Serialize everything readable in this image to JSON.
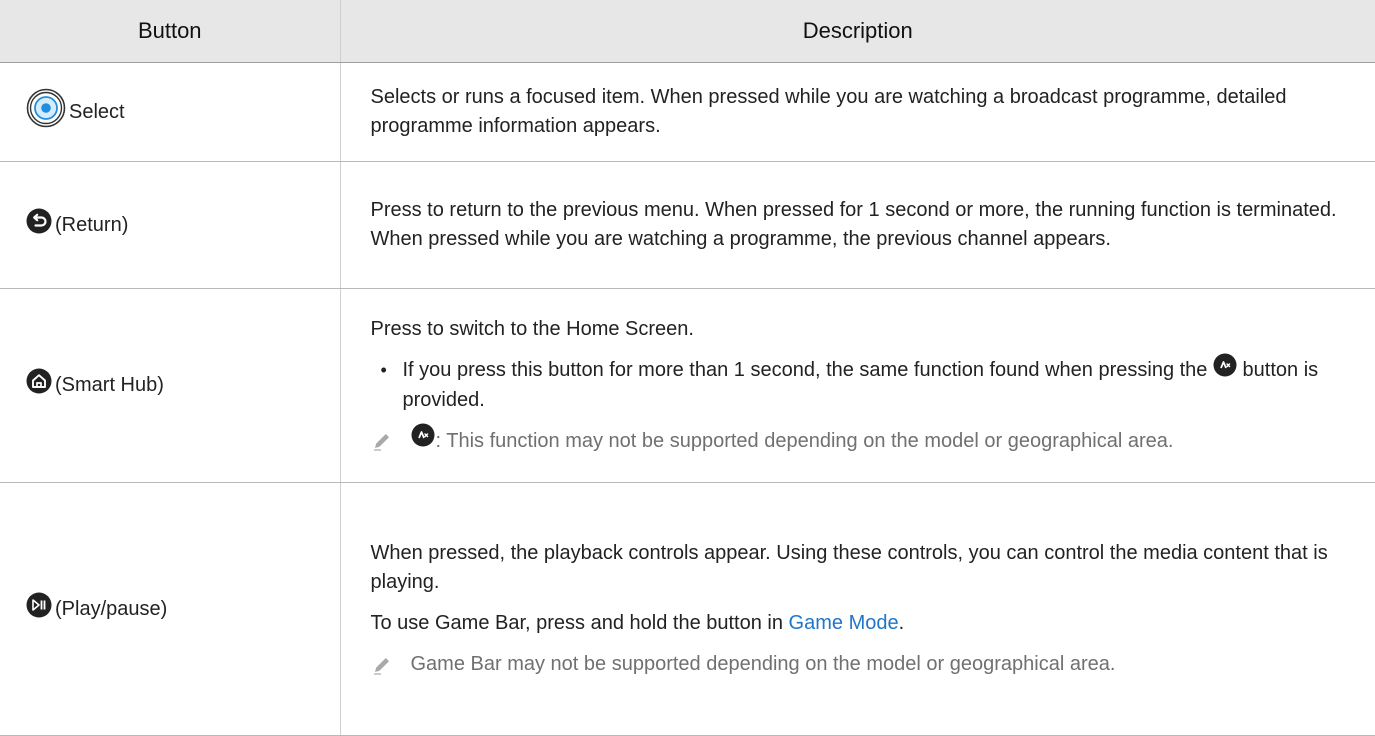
{
  "table": {
    "headers": {
      "button": "Button",
      "description": "Description"
    },
    "rows": {
      "select": {
        "button_label": "Select",
        "icon": "select-ring-icon",
        "description": "Selects or runs a focused item. When pressed while you are watching a broadcast programme, detailed programme information appears."
      },
      "return": {
        "button_label": "(Return)",
        "icon": "return-icon",
        "description": "Press to return to the previous menu. When pressed for 1 second or more, the running function is terminated. When pressed while you are watching a programme, the previous channel appears."
      },
      "smart_hub": {
        "button_label": "(Smart Hub)",
        "icon": "home-icon",
        "description": "Press to switch to the Home Screen.",
        "bullet_before": "If you press this button for more than 1 second, the same function found when pressing the",
        "bullet_after": "button is provided.",
        "note": ": This function may not be supported depending on the model or geographical area."
      },
      "play_pause": {
        "button_label": "(Play/pause)",
        "icon": "play-pause-icon",
        "description": "When pressed, the playback controls appear. Using these controls, you can control the media content that is playing.",
        "game_bar_before": "To use Game Bar, press and hold the button in",
        "game_bar_link": "Game Mode",
        "game_bar_after": ".",
        "note": "Game Bar may not be supported depending on the model or geographical area."
      }
    }
  },
  "colors": {
    "header_bg": "#e7e7e7",
    "icon_fill": "#222222",
    "select_ring": "#1f8ee0",
    "link": "#1f76c9",
    "note_text": "#707070"
  }
}
